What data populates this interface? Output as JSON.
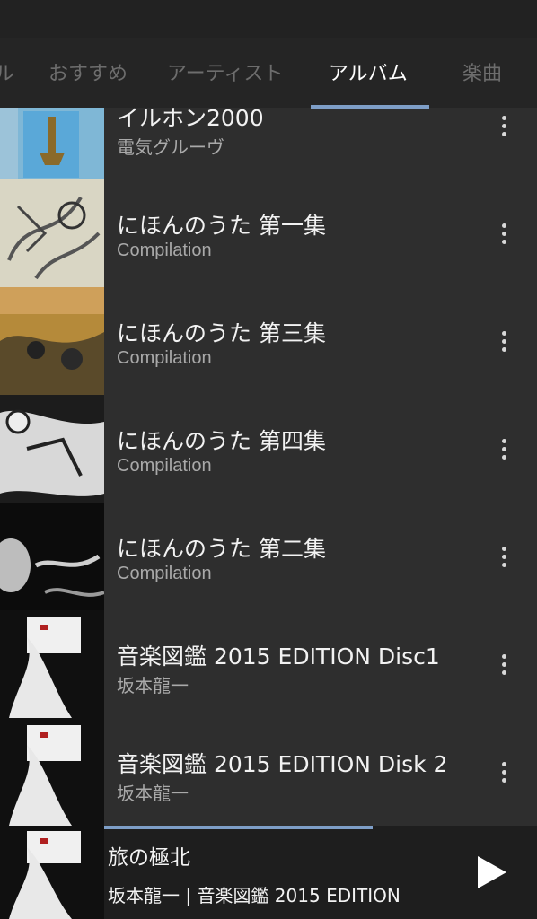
{
  "tabs": [
    {
      "label": "ル"
    },
    {
      "label": "おすすめ"
    },
    {
      "label": "アーティスト"
    },
    {
      "label": "アルバム",
      "active": true
    },
    {
      "label": "楽曲"
    }
  ],
  "albums": [
    {
      "title": "イルホン2000",
      "artist": "電気グルーヴ",
      "menu_icon": "more-vert-icon"
    },
    {
      "title": "にほんのうた 第一集",
      "artist": "Compilation",
      "menu_icon": "more-vert-icon"
    },
    {
      "title": "にほんのうた 第三集",
      "artist": "Compilation",
      "menu_icon": "more-vert-icon"
    },
    {
      "title": "にほんのうた 第四集",
      "artist": "Compilation",
      "menu_icon": "more-vert-icon"
    },
    {
      "title": "にほんのうた 第二集",
      "artist": "Compilation",
      "menu_icon": "more-vert-icon"
    },
    {
      "title": "音楽図鑑 2015 EDITION Disc1",
      "artist": "坂本龍一",
      "menu_icon": "more-vert-icon"
    },
    {
      "title": "音楽図鑑 2015 EDITION Disk 2",
      "artist": "坂本龍一",
      "menu_icon": "more-vert-icon"
    }
  ],
  "now_playing": {
    "title": "旅の極北",
    "subtitle": "坂本龍一 | 音楽図鑑 2015 EDITION",
    "progress_fraction": 0.62,
    "play_icon": "play-icon"
  },
  "colors": {
    "accent": "#7e9ec7",
    "background": "#2e2e2e",
    "tab_bar": "#252525",
    "player_bar": "#1e1e1e"
  }
}
